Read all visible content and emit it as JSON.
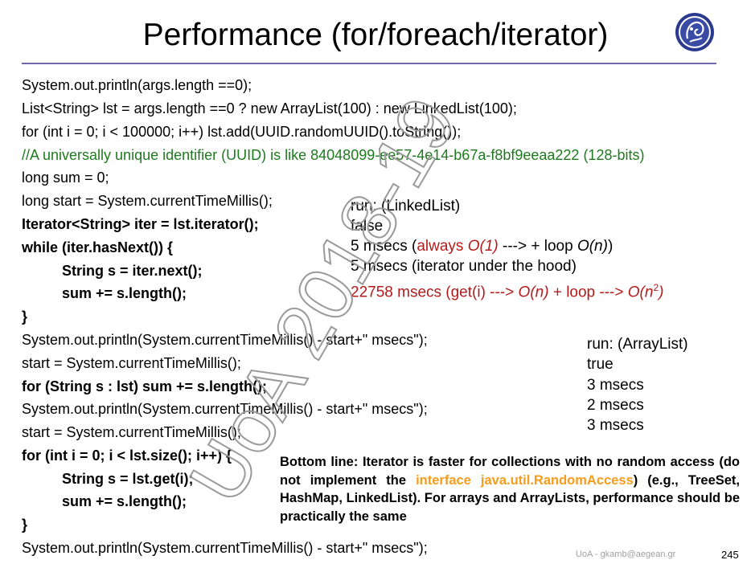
{
  "slide": {
    "title": "Performance (for/foreach/iterator)",
    "watermark": "UoA 2018-19",
    "footer": "UoA - gkamb@aegean.gr",
    "page_number": "245"
  },
  "code": {
    "l1": "System.out.println(args.length ==0);",
    "l2": "List<String> lst = args.length ==0 ? new ArrayList(100) : new LinkedList(100);",
    "l3": "for (int i = 0; i < 100000; i++) lst.add(UUID.randomUUID().toString());",
    "l4": "//A universally unique identifier (UUID) is like 84048099-ee57-4e14-b67a-f8bf9eeaa222 (128-bits)",
    "l5": "long sum = 0;",
    "l6": "long start = System.currentTimeMillis();",
    "l7": "Iterator<String> iter = lst.iterator();",
    "l8": "while (iter.hasNext()) {",
    "l9": "String s = iter.next();",
    "l10": "sum += s.length();",
    "l11": "}",
    "l12": "System.out.println(System.currentTimeMillis() - start+\" msecs\");",
    "l13": "start = System.currentTimeMillis();",
    "l14": "for (String s : lst) sum += s.length();",
    "l15": "System.out.println(System.currentTimeMillis() - start+\" msecs\");",
    "l16": "start = System.currentTimeMillis();",
    "l17": "for (int i = 0; i < lst.size(); i++) {",
    "l18": "String s = lst.get(i);",
    "l19": "sum += s.length();",
    "l20": "}",
    "l21": "System.out.println(System.currentTimeMillis() - start+\" msecs\");"
  },
  "output_linked": {
    "run": "run: (LinkedList)",
    "bool": "false",
    "r1_prefix": "5 msecs (",
    "r1_always": "always ",
    "r1_o1": "O(1)",
    "r1_mid": " ---> + loop ",
    "r1_on": "O(n)",
    "r1_suffix": ")",
    "r2": "5 msecs (iterator under the hood)",
    "r3_prefix": "22758 msecs (get(i) ---> ",
    "r3_on": "O(n)",
    "r3_mid": " + loop ---> ",
    "r3_on2": "O(n",
    "r3_sup": "2",
    "r3_close": ")",
    "r3_paren": ")"
  },
  "output_array": {
    "run": "run: (ArrayList)",
    "bool": "true",
    "r1": "3 msecs",
    "r2": "2 msecs",
    "r3": "3 msecs"
  },
  "bottom_line": {
    "p1": "Bottom line: Iterator is faster for collections with no random access (do not implement the ",
    "highlight": "interface java.util.RandomAccess",
    "p2": ") (e.g., TreeSet, HashMap, LinkedList). For arrays and ArrayLists, performance should be practically the same"
  },
  "colors": {
    "comment": "#1f7a1f",
    "emphasis": "#b31b1b",
    "highlight": "#f59c1b",
    "rule": "#6d6ab0"
  }
}
